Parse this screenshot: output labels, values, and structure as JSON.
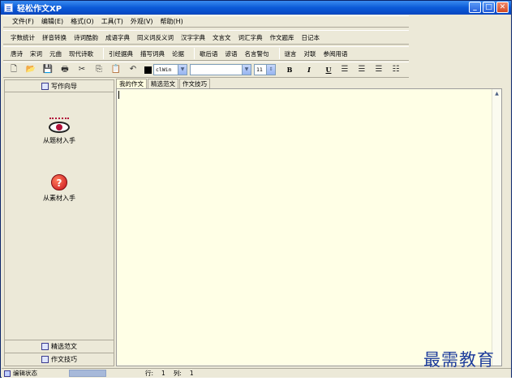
{
  "window": {
    "title": "轻松作文XP"
  },
  "menu": [
    "文件(F)",
    "编辑(E)",
    "格式(O)",
    "工具(T)",
    "外观(V)",
    "帮助(H)"
  ],
  "toolbar_row1": [
    "字数统计",
    "拼音转换",
    "诗词酷韵",
    "成语字典",
    "同义词反义词",
    "汉字字典",
    "文言文",
    "词汇字典",
    "作文题库",
    "日记本"
  ],
  "toolbar_row2": {
    "g1": [
      "唐诗",
      "宋词",
      "元曲",
      "现代诗歌"
    ],
    "g2": [
      "引经据典",
      "描写词典",
      "论据"
    ],
    "g3": [
      "歇后语",
      "谚语",
      "名言警句"
    ],
    "g4": [
      "谜言",
      "对联",
      "参阅用语"
    ]
  },
  "format": {
    "color_label": "clWin",
    "font_name": "",
    "font_size": "11",
    "bold": "B",
    "italic": "I",
    "underline": "U"
  },
  "left_panel": {
    "top": "写作向导",
    "items": [
      "从题材入手",
      "从素材入手"
    ],
    "bottom": [
      "精选范文",
      "作文技巧"
    ]
  },
  "tabs": [
    "我的作文",
    "精选范文",
    "作文技巧"
  ],
  "status": {
    "state": "编辑状态",
    "row_label": "行:",
    "row_value": "1",
    "col_label": "列:",
    "col_value": "1"
  },
  "watermark": "最需教育"
}
